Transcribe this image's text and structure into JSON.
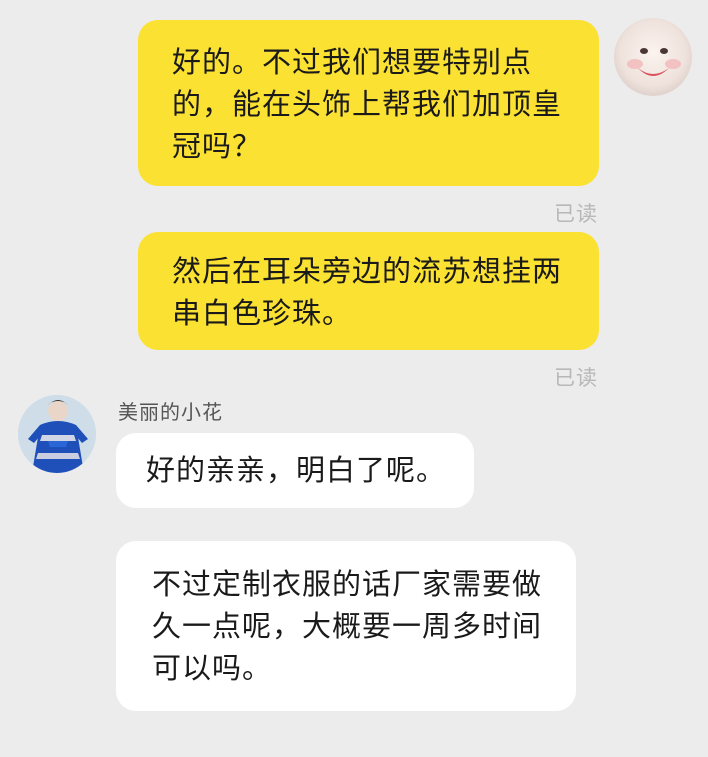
{
  "messages": [
    {
      "direction": "outgoing",
      "text": "好的。不过我们想要特别点的，能在头饰上帮我们加顶皇冠吗？",
      "status": "已读"
    },
    {
      "direction": "outgoing",
      "text": "然后在耳朵旁边的流苏想挂两串白色珍珠。",
      "status": "已读"
    },
    {
      "direction": "incoming",
      "sender": "美丽的小花",
      "text": "好的亲亲，明白了呢。"
    },
    {
      "direction": "incoming",
      "text": "不过定制衣服的话厂家需要做久一点呢，大概要一周多时间可以吗。"
    }
  ],
  "avatars": {
    "me": "smiling-face-avatar",
    "contact": "girl-in-blue-dress-avatar"
  },
  "colors": {
    "background": "#ececec",
    "outgoing_bubble": "#fbe132",
    "incoming_bubble": "#ffffff",
    "read_receipt": "#b8b8b8"
  }
}
